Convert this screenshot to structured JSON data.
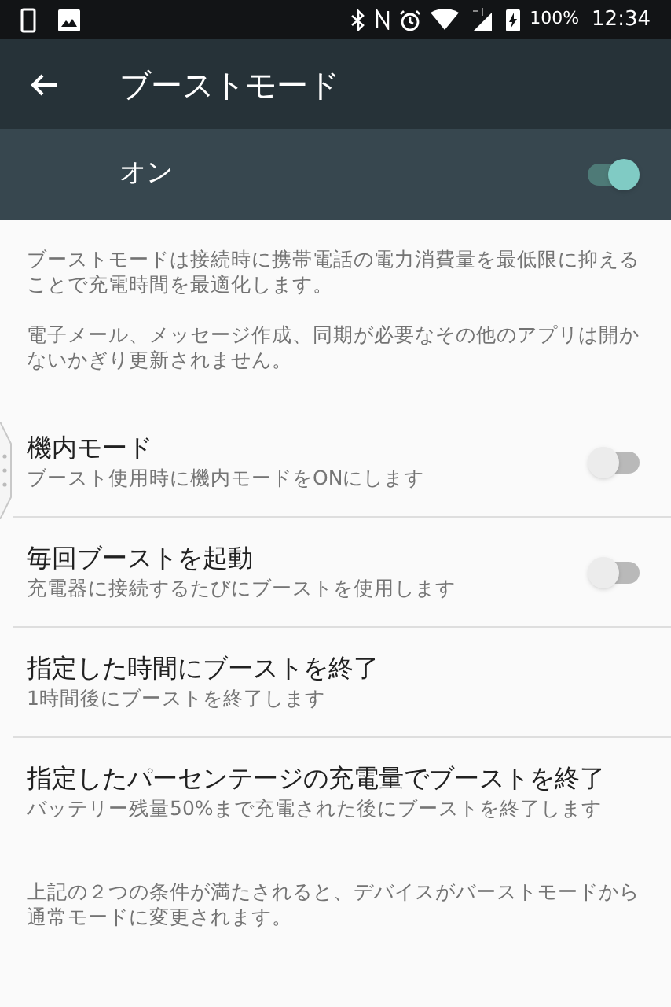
{
  "status_bar": {
    "battery": "100%",
    "time": "12:34"
  },
  "toolbar": {
    "title": "ブーストモード"
  },
  "master_switch": {
    "label": "オン",
    "on": true
  },
  "description": [
    "ブーストモードは接続時に携帯電話の電力消費量を最低限に抑えることで充電時間を最適化します。",
    "電子メール、メッセージ作成、同期が必要なその他のアプリは開かないかぎり更新されません。"
  ],
  "settings": [
    {
      "kind": "toggle",
      "title": "機内モード",
      "summary": "ブースト使用時に機内モードをONにします",
      "on": false
    },
    {
      "kind": "toggle",
      "title": "毎回ブーストを起動",
      "summary": "充電器に接続するたびにブーストを使用します",
      "on": false
    },
    {
      "kind": "plain",
      "title": "指定した時間にブーストを終了",
      "summary": "1時間後にブーストを終了します"
    },
    {
      "kind": "plain",
      "title": "指定したパーセンテージの充電量でブーストを終了",
      "summary": "バッテリー残量50%まで充電された後にブーストを終了します"
    }
  ],
  "footer": "上記の２つの条件が満たされると、デバイスがバーストモードから通常モードに変更されます。"
}
